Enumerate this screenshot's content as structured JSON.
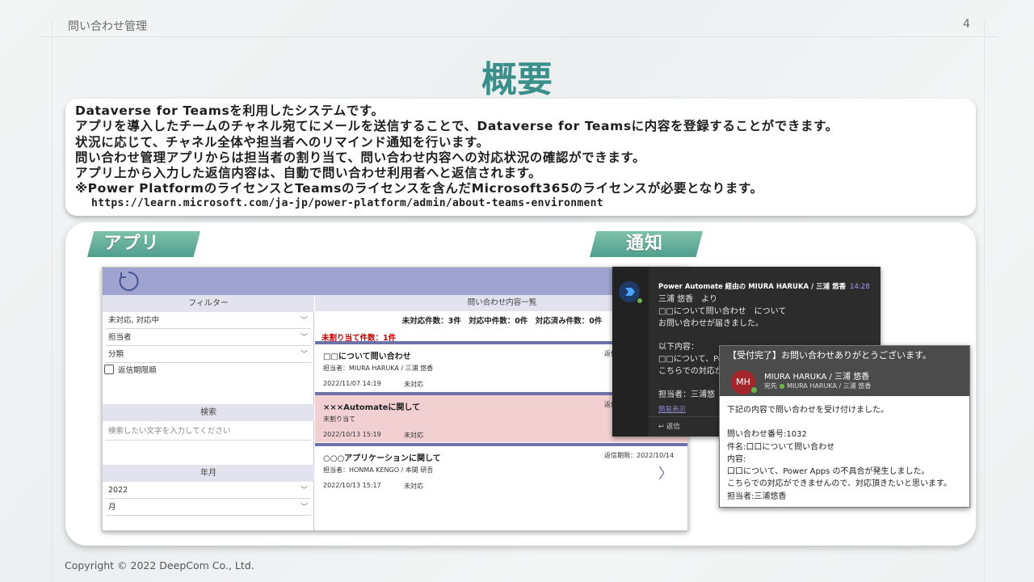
{
  "header": {
    "title": "問い合わせ管理",
    "page_number": "4"
  },
  "main_title": "概要",
  "description": {
    "lines": [
      "Dataverse for Teamsを利用したシステムです。",
      "アプリを導入したチームのチャネル宛てにメールを送信することで、Dataverse for Teamsに内容を登録することができます。",
      "状況に応じて、チャネル全体や担当者へのリマインド通知を行います。",
      "問い合わせ管理アプリからは担当者の割り当て、問い合わせ内容への対応状況の確認ができます。",
      "アプリ上から入力した返信内容は、自動で問い合わせ利用者へと返信されます。",
      "※Power PlatformのライセンスとTeamsのライセンスを含んだMicrosoft365のライセンスが必要となります。"
    ],
    "url": "https://learn.microsoft.com/ja-jp/power-platform/admin/about-teams-environment"
  },
  "ribbons": {
    "app": "アプリ",
    "notify": "通知"
  },
  "app": {
    "filter_header": "フィルター",
    "filters": [
      "未対応, 対応中",
      "担当者",
      "分類"
    ],
    "checkbox_label": "返信期限順",
    "search_header": "検索",
    "search_placeholder": "検索したい文字を入力してください",
    "yearmonth_header": "年月",
    "year": "2022",
    "month": "月",
    "list_header": "問い合わせ内容一覧",
    "counts": "未対応件数：3件　対応中件数：0件　対応済み件数：0件",
    "unassigned": "未割り当て件数：1件",
    "items": [
      {
        "title": "□□について問い合わせ",
        "sub": "担当者：MIURA HARUKA / 三浦 悠香",
        "date": "2022/11/07 14:19",
        "status": "未対応",
        "due": "返信",
        "highlight": false
      },
      {
        "title": "×××Automateに関して",
        "sub": "未割り当て",
        "date": "2022/10/13 15:19",
        "status": "未対応",
        "due": "返信",
        "highlight": true
      },
      {
        "title": "○○○アプリケーションに関して",
        "sub": "担当者：HONMA KENGO / 本間 研吾",
        "date": "2022/10/13 15:17",
        "status": "未対応",
        "due": "返信期限：2022/10/14",
        "highlight": false
      }
    ]
  },
  "teams": {
    "sender": "Power Automate 経由の MIURA HARUKA / 三浦 悠香",
    "time": "14:28",
    "lines": [
      "三浦 悠香　より",
      "□□について問い合わせ　について",
      "お問い合わせが届きました。"
    ],
    "content_label": "以下内容：",
    "content_lines": [
      "□□について、Power",
      "こちらでの対応がで"
    ],
    "assignee": "担当者：三浦悠",
    "simple_view": "簡易表示",
    "reply": "返信"
  },
  "mail": {
    "subject": "【受付完了】お問い合わせありがとうございます。",
    "avatar": "MH",
    "from": "MIURA HARUKA / 三浦 悠香",
    "to_label": "宛先",
    "to_name": "MIURA HARUKA / 三浦 悠香",
    "body": [
      "下記の内容で問い合わせを受け付けました。",
      "",
      "問い合わせ番号:1032",
      "件名:口口について問い合わせ",
      "内容:",
      "口口について、Power Apps の不具合が発生しました。",
      "こちらでの対応ができませんので、対応頂きたいと思います。",
      "担当者:三浦悠香"
    ]
  },
  "footer": {
    "copyright": "Copyright © 2022 DeepCom Co., Ltd."
  },
  "colors": {
    "accent": "#3a8f8a",
    "app_bar": "#9ea4cf",
    "item_rule": "#6d72a8",
    "highlight": "#f2d0d2",
    "alert": "#c00000"
  }
}
